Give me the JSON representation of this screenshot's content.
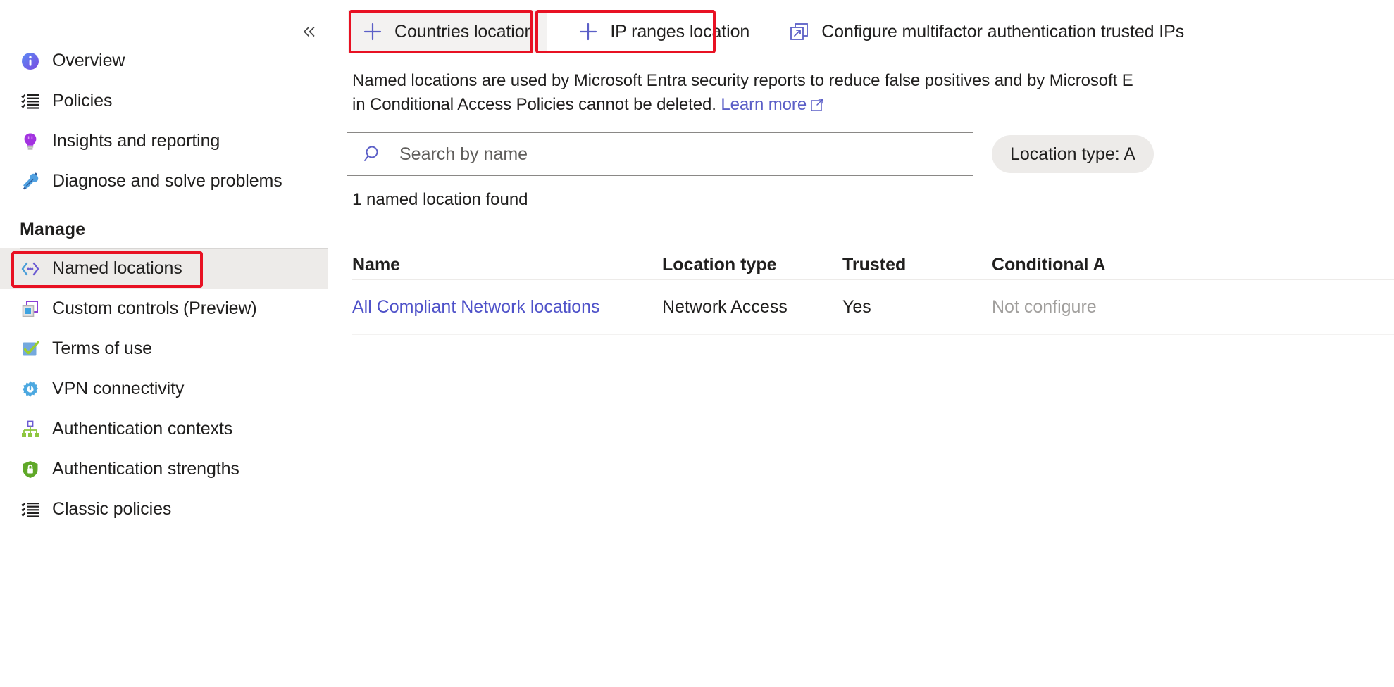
{
  "sidebar": {
    "collapse_icon": "chevron-double-left-icon",
    "items": [
      {
        "label": "Overview",
        "icon": "info-icon"
      },
      {
        "label": "Policies",
        "icon": "checklist-icon"
      },
      {
        "label": "Insights and reporting",
        "icon": "lightbulb-icon"
      },
      {
        "label": "Diagnose and solve problems",
        "icon": "tools-icon"
      }
    ],
    "manage_header": "Manage",
    "manage_items": [
      {
        "label": "Named locations",
        "icon": "named-locations-icon",
        "selected": true,
        "highlighted": true
      },
      {
        "label": "Custom controls (Preview)",
        "icon": "custom-controls-icon",
        "selected": false,
        "highlighted": false
      },
      {
        "label": "Terms of use",
        "icon": "checkbox-check-icon",
        "selected": false,
        "highlighted": false
      },
      {
        "label": "VPN connectivity",
        "icon": "gear-icon",
        "selected": false,
        "highlighted": false
      },
      {
        "label": "Authentication contexts",
        "icon": "sitemap-icon",
        "selected": false,
        "highlighted": false
      },
      {
        "label": "Authentication strengths",
        "icon": "shield-lock-icon",
        "selected": false,
        "highlighted": false
      },
      {
        "label": "Classic policies",
        "icon": "checklist-icon",
        "selected": false,
        "highlighted": false
      }
    ]
  },
  "toolbar": {
    "countries_label": "Countries location",
    "countries_icon": "plus-icon",
    "ip_ranges_label": "IP ranges location",
    "ip_ranges_icon": "plus-icon",
    "configure_mfa_label": "Configure multifactor authentication trusted IPs",
    "configure_mfa_icon": "external-link-icon"
  },
  "description": {
    "line1": "Named locations are used by Microsoft Entra security reports to reduce false positives and by Microsoft E",
    "line2_before_link": "in Conditional Access Policies cannot be deleted. ",
    "learn_more": "Learn more",
    "learn_more_icon": "external-link-icon"
  },
  "search": {
    "placeholder": "Search by name",
    "value": "",
    "icon": "search-icon"
  },
  "filter": {
    "location_type_label": "Location type: A"
  },
  "results": {
    "count_text": "1 named location found"
  },
  "table": {
    "columns": [
      "Name",
      "Location type",
      "Trusted",
      "Conditional A"
    ],
    "rows": [
      {
        "name": "All Compliant Network locations",
        "location_type": "Network Access",
        "trusted": "Yes",
        "conditional_access": "Not configure"
      }
    ]
  },
  "colors": {
    "highlight_red": "#e81123",
    "accent_blue": "#5b5fc7",
    "link_blue": "#4f52c9",
    "selected_bg": "#edebe9"
  }
}
